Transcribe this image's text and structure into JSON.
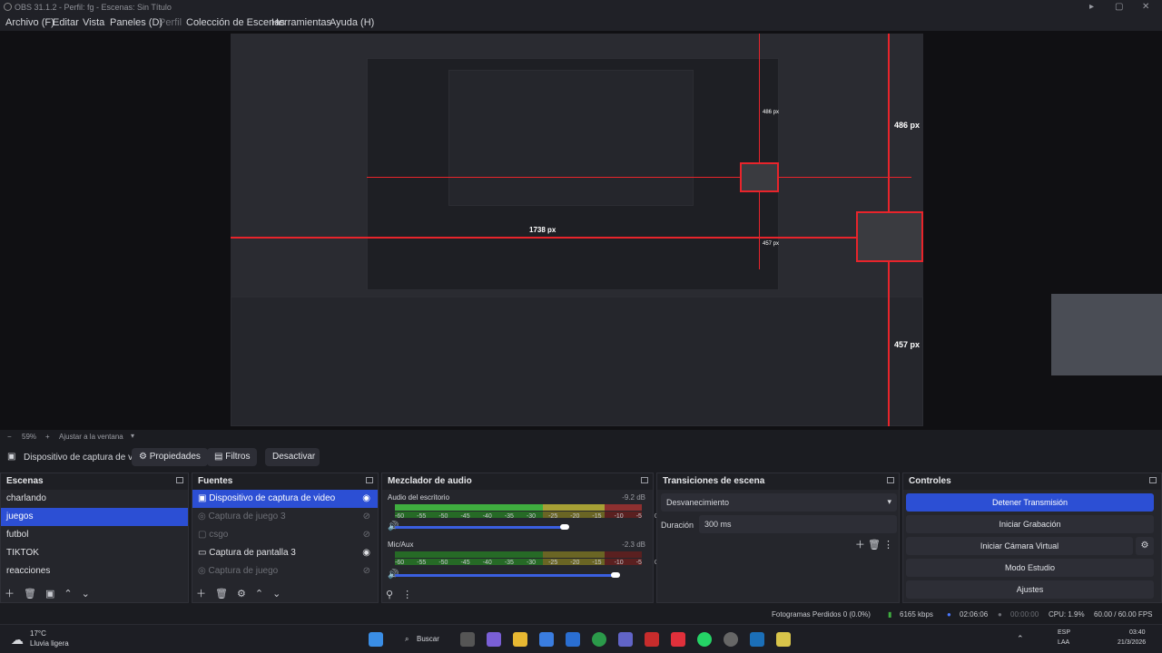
{
  "window": {
    "title": "OBS 31.1.2 - Perfil: fg - Escenas: Sin Título"
  },
  "menu": [
    "Archivo (F)",
    "Editar",
    "Vista",
    "Paneles (D)",
    "Perfil",
    "Colección de Escenas",
    "Herramientas",
    "Ayuda (H)"
  ],
  "preview": {
    "measure_top": "486 px",
    "measure_left": "1738 px",
    "measure_right": "457 px",
    "inner_measure_top": "486 px",
    "inner_measure_right": "457 px"
  },
  "zoom": {
    "percent": "59%",
    "fit_label": "Ajustar a la ventana"
  },
  "source_bar": {
    "source_name": "Dispositivo de captura de v",
    "properties": "Propiedades",
    "filters": "Filtros",
    "deactivate": "Desactivar"
  },
  "scenes": {
    "title": "Escenas",
    "items": [
      "charlando",
      "juegos",
      "futbol",
      "TIKTOK",
      "reacciones"
    ],
    "selected": 1
  },
  "sources": {
    "title": "Fuentes",
    "items": [
      {
        "label": "Dispositivo de captura de video",
        "dim": false
      },
      {
        "label": "Captura de juego 3",
        "dim": true
      },
      {
        "label": "csgo",
        "dim": true
      },
      {
        "label": "Captura de pantalla 3",
        "dim": false
      },
      {
        "label": "Captura de juego",
        "dim": true
      }
    ]
  },
  "mixer": {
    "title": "Mezclador de audio",
    "tracks": [
      {
        "name": "Audio del escritorio",
        "db": "-9.2 dB",
        "level": 0.98
      },
      {
        "name": "Mic/Aux",
        "db": "-2.3 dB",
        "level": 0.78
      }
    ],
    "ticks": [
      "-60",
      "-55",
      "-50",
      "-45",
      "-40",
      "-35",
      "-30",
      "-25",
      "-20",
      "-15",
      "-10",
      "-5",
      "0"
    ]
  },
  "transitions": {
    "title": "Transiciones de escena",
    "selected": "Desvanecimiento",
    "duration_label": "Duración",
    "duration_value": "300 ms"
  },
  "controls": {
    "title": "Controles",
    "buttons": [
      "Detener Transmisión",
      "Iniciar Grabación",
      "Iniciar Cámara Virtual",
      "Modo Estudio",
      "Ajustes"
    ]
  },
  "status": {
    "dropped": "Fotogramas Perdidos 0 (0.0%)",
    "bitrate": "6165 kbps",
    "stream_time": "02:06:06",
    "rec_time": "00:00:00",
    "cpu": "CPU: 1.9%",
    "fps": "60.00 / 60.00 FPS"
  },
  "taskbar": {
    "weather_temp": "17°C",
    "weather_desc": "Lluvia ligera",
    "search": "Buscar",
    "lang1": "ESP",
    "lang2": "LAA",
    "time": "03:40",
    "date": "21/3/2026"
  },
  "colors": {
    "accent": "#2c4fd4",
    "marker": "#e8242b",
    "bg": "#1b1c21"
  }
}
